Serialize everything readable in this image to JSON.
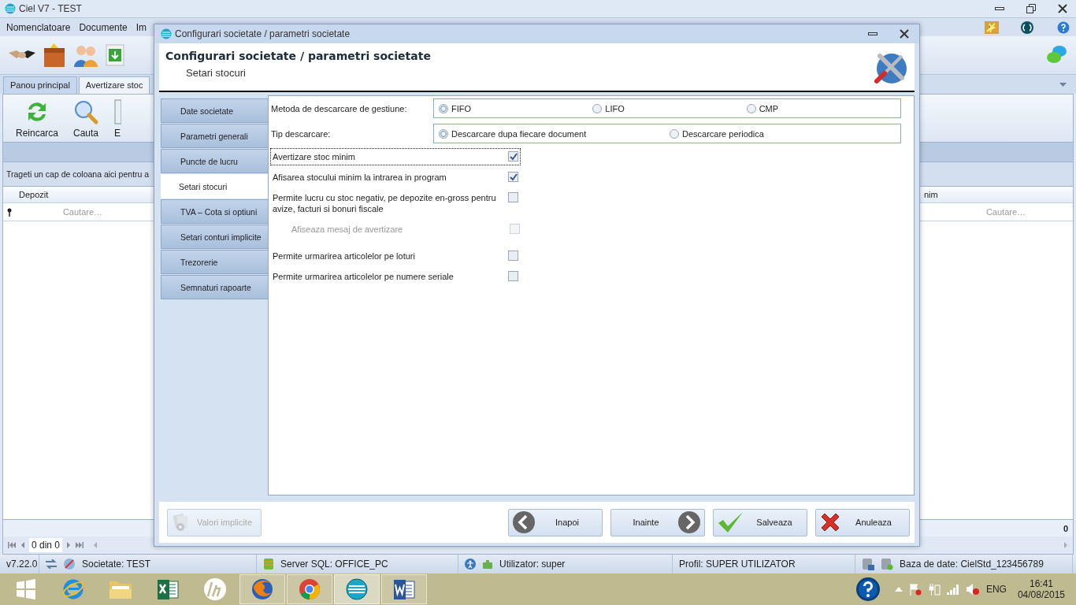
{
  "app": {
    "title": "Ciel V7 - TEST",
    "menu": [
      "Nomenclatoare",
      "Documente",
      "Im"
    ],
    "tabs": [
      {
        "label": "Panou principal",
        "selected": false
      },
      {
        "label": "Avertizare stoc",
        "selected": true
      }
    ],
    "ribbon": [
      {
        "kind": "reload",
        "label": "Reincarca"
      },
      {
        "kind": "search",
        "label": "Cauta"
      },
      {
        "kind": "export",
        "label": "E"
      }
    ],
    "grid": {
      "group_hint": "Trageti un cap de coloana aici pentru a",
      "columns": [
        "Depozit",
        "nim"
      ],
      "filters": [
        "Cautare…",
        "Cautare…"
      ],
      "total": "0",
      "pager": "0 din 0"
    }
  },
  "status_bar": {
    "version": "v7.22.0",
    "company": "Societate: TEST",
    "server": "Server SQL: OFFICE_PC",
    "user": "Utilizator: super",
    "profile": "Profil: SUPER UTILIZATOR",
    "database": "Baza de date: CielStd_123456789"
  },
  "dialog": {
    "title": "Configurari societate / parametri societate",
    "heading": "Configurari societate / parametri societate",
    "subheading": "Setari stocuri",
    "nav": [
      {
        "label": "Date societate",
        "selected": false
      },
      {
        "label": "Parametri generali",
        "selected": false
      },
      {
        "label": "Puncte de lucru",
        "selected": false
      },
      {
        "label": "Setari stocuri",
        "selected": true
      },
      {
        "label": "TVA – Cota si optiuni",
        "selected": false
      },
      {
        "label": "Setari conturi implicite",
        "selected": false
      },
      {
        "label": "Trezorerie",
        "selected": false
      },
      {
        "label": "Semnaturi rapoarte",
        "selected": false
      }
    ],
    "radio_groups": [
      {
        "label": "Metoda de descarcare de gestiune:",
        "options": [
          {
            "label": "FIFO",
            "selected": true
          },
          {
            "label": "LIFO",
            "selected": false
          },
          {
            "label": "CMP",
            "selected": false
          }
        ]
      },
      {
        "label": "Tip descarcare:",
        "options": [
          {
            "label": "Descarcare dupa fiecare document",
            "selected": true
          },
          {
            "label": "Descarcare periodica",
            "selected": false
          }
        ]
      }
    ],
    "checkboxes": [
      {
        "label": "Avertizare stoc minim",
        "checked": true,
        "disabled": false,
        "focused": true,
        "indented": false
      },
      {
        "label": "Afisarea stocului minim la intrarea in program",
        "checked": true,
        "disabled": false,
        "focused": false,
        "indented": false
      },
      {
        "label": "Permite lucru cu stoc negativ, pe depozite en-gross pentru avize, facturi si bonuri fiscale",
        "checked": false,
        "disabled": false,
        "focused": false,
        "indented": false
      },
      {
        "label": "Afiseaza mesaj de avertizare",
        "checked": false,
        "disabled": true,
        "focused": false,
        "indented": true
      },
      {
        "label": "Permite urmarirea articolelor pe loturi",
        "checked": false,
        "disabled": false,
        "focused": false,
        "indented": false
      },
      {
        "label": "Permite urmarirea articolelor pe numere seriale",
        "checked": false,
        "disabled": false,
        "focused": false,
        "indented": false
      }
    ],
    "buttons": [
      {
        "kind": "defaults",
        "label": "Valori implicite",
        "disabled": true
      },
      {
        "kind": "back",
        "label": "Inapoi",
        "disabled": false
      },
      {
        "kind": "next",
        "label": "Inainte",
        "disabled": false
      },
      {
        "kind": "save",
        "label": "Salveaza",
        "disabled": false
      },
      {
        "kind": "cancel",
        "label": "Anuleaza",
        "disabled": false
      }
    ]
  },
  "taskbar": {
    "apps": [
      {
        "kind": "ie",
        "open": false,
        "active": false
      },
      {
        "kind": "folder",
        "open": false,
        "active": false
      },
      {
        "kind": "excel",
        "open": false,
        "active": false
      },
      {
        "kind": "hp",
        "open": false,
        "active": false
      },
      {
        "kind": "firefox",
        "open": true,
        "active": false
      },
      {
        "kind": "chrome",
        "open": true,
        "active": false
      },
      {
        "kind": "ciel",
        "open": true,
        "active": true
      },
      {
        "kind": "word",
        "open": true,
        "active": false
      }
    ],
    "language": "ENG",
    "time": "16:41",
    "date": "04/08/2015"
  }
}
